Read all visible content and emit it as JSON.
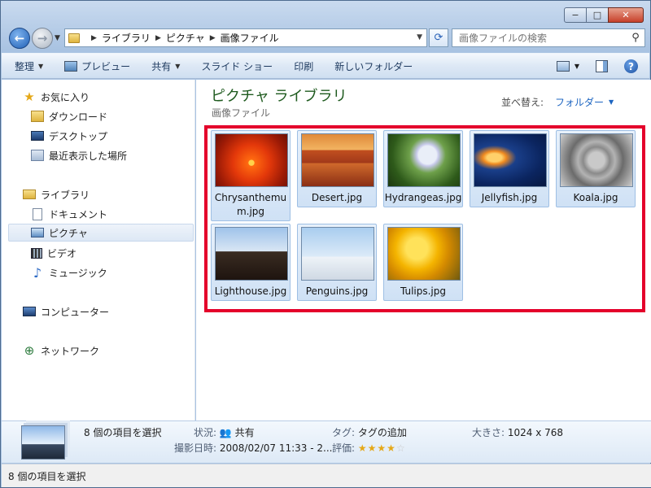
{
  "window": {
    "minimize": "−",
    "maximize": "□",
    "close": "✕"
  },
  "breadcrumbs": [
    "ライブラリ",
    "ピクチャ",
    "画像ファイル"
  ],
  "search": {
    "placeholder": "画像ファイルの検索"
  },
  "toolbar": {
    "organize": "整理",
    "preview": "プレビュー",
    "share": "共有",
    "slideshow": "スライド ショー",
    "print": "印刷",
    "new_folder": "新しいフォルダー"
  },
  "nav": {
    "favorites": "お気に入り",
    "downloads": "ダウンロード",
    "desktop": "デスクトップ",
    "recent": "最近表示した場所",
    "libraries": "ライブラリ",
    "documents": "ドキュメント",
    "pictures": "ピクチャ",
    "videos": "ビデオ",
    "music": "ミュージック",
    "computer": "コンピューター",
    "network": "ネットワーク"
  },
  "content": {
    "library_title": "ピクチャ ライブラリ",
    "library_subtitle": "画像ファイル",
    "arrange_label": "並べ替え:",
    "arrange_value": "フォルダー"
  },
  "files": [
    {
      "name": "Chrysanthemum.jpg",
      "label_line1": "Chrysanthemu",
      "label_line2": "m.jpg"
    },
    {
      "name": "Desert.jpg"
    },
    {
      "name": "Hydrangeas.jpg"
    },
    {
      "name": "Jellyfish.jpg"
    },
    {
      "name": "Koala.jpg"
    },
    {
      "name": "Lighthouse.jpg"
    },
    {
      "name": "Penguins.jpg"
    },
    {
      "name": "Tulips.jpg"
    }
  ],
  "details": {
    "selected": "8 個の項目を選択",
    "status_key": "状況:",
    "status_value": "共有",
    "tags_key": "タグ:",
    "tags_value": "タグの追加",
    "size_key": "大きさ:",
    "size_value": "1024 x 768",
    "date_key": "撮影日時:",
    "date_value": "2008/02/07 11:33 - 2...",
    "rating_key": "評価:",
    "rating": 4,
    "rating_max": 5
  },
  "statusbar": {
    "text": "8 個の項目を選択"
  },
  "colors": {
    "highlight_border": "#e4002b",
    "library_title": "#1e5a1e",
    "link": "#1d65c1"
  }
}
